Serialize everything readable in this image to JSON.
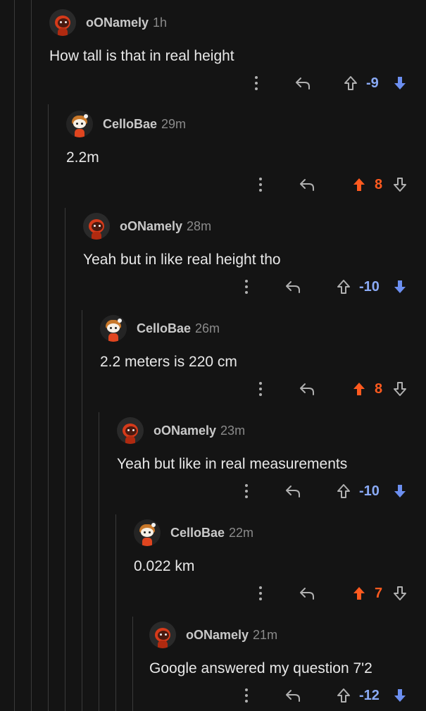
{
  "colors": {
    "upvote": "#ff5a1f",
    "downvote": "#6c8ff0",
    "thread_line": "#3a3a3a",
    "background": "#141414"
  },
  "comments": [
    {
      "username": "oONamely",
      "time": "1h",
      "text": "How tall is that in real height",
      "score": "-9",
      "vote": "down",
      "avatar": "snoo-dark"
    },
    {
      "username": "CelloBae",
      "time": "29m",
      "text": "2.2m",
      "score": "8",
      "vote": "up",
      "avatar": "snoo-light"
    },
    {
      "username": "oONamely",
      "time": "28m",
      "text": "Yeah but in like real height tho",
      "score": "-10",
      "vote": "down",
      "avatar": "snoo-dark"
    },
    {
      "username": "CelloBae",
      "time": "26m",
      "text": "2.2 meters is 220 cm",
      "score": "8",
      "vote": "up",
      "avatar": "snoo-light"
    },
    {
      "username": "oONamely",
      "time": "23m",
      "text": "Yeah but like in real measurements",
      "score": "-10",
      "vote": "down",
      "avatar": "snoo-dark"
    },
    {
      "username": "CelloBae",
      "time": "22m",
      "text": "0.022 km",
      "score": "7",
      "vote": "up",
      "avatar": "snoo-light"
    },
    {
      "username": "oONamely",
      "time": "21m",
      "text": "Google answered my question 7'2",
      "score": "-12",
      "vote": "down",
      "avatar": "snoo-dark"
    }
  ]
}
